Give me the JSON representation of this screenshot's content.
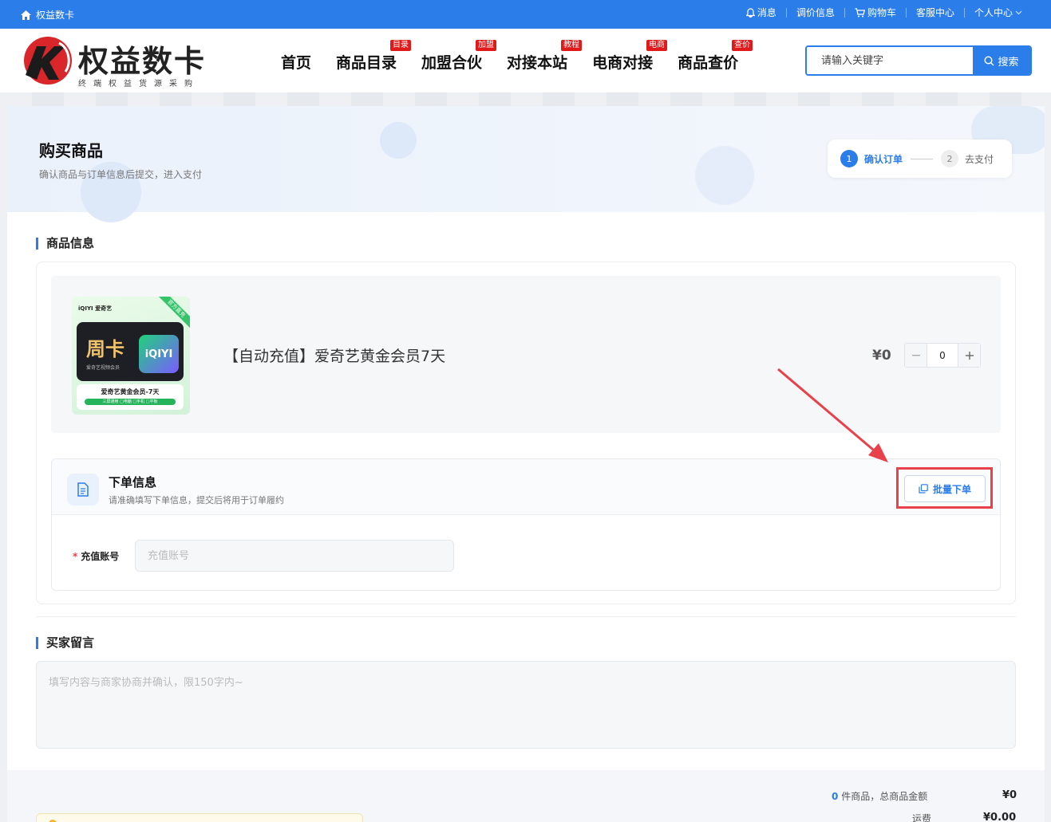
{
  "topbar": {
    "site_name": "权益数卡",
    "links": [
      "消息",
      "调价信息",
      "购物车",
      "客服中心",
      "个人中心"
    ]
  },
  "logo": {
    "name": "权益数卡",
    "slogan": "终端权益货源采购"
  },
  "nav": [
    {
      "label": "首页",
      "badge": ""
    },
    {
      "label": "商品目录",
      "badge": "目录"
    },
    {
      "label": "加盟合伙",
      "badge": "加盟"
    },
    {
      "label": "对接本站",
      "badge": "教程"
    },
    {
      "label": "电商对接",
      "badge": "电商"
    },
    {
      "label": "商品查价",
      "badge": "查价"
    }
  ],
  "search": {
    "placeholder": "请输入关键字",
    "button": "搜索"
  },
  "hero": {
    "title": "购买商品",
    "subtitle": "确认商品与订单信息后提交，进入支付"
  },
  "steps": [
    {
      "num": "1",
      "label": "确认订单"
    },
    {
      "num": "2",
      "label": "去支付"
    }
  ],
  "product_section": {
    "title": "商品信息"
  },
  "product": {
    "title": "【自动充值】爱奇艺黄金会员7天",
    "price": "¥0",
    "quantity": "0",
    "thumb": {
      "tag": "官方直充",
      "brand": "iQIYI 爱奇艺",
      "big_text": "周卡",
      "small_text": "爱奇艺视频会员",
      "logo_text": "iQIYI",
      "bottom_title": "爱奇艺黄金会员-7天",
      "bottom_bar": "三屏通用 □电脑 □手机 □平板"
    }
  },
  "order_info": {
    "title": "下单信息",
    "subtitle": "请准确填写下单信息，提交后将用于订单履约",
    "batch_button": "批量下单",
    "account_label": "充值账号",
    "account_placeholder": "充值账号"
  },
  "message_section": {
    "title": "买家留言",
    "placeholder": "填写内容与商家协商并确认，限150字内~"
  },
  "summary": {
    "count": "0",
    "count_text": "件商品，总商品金额",
    "amount": "¥0",
    "shipping_label": "运费",
    "shipping_value": "¥0.00"
  },
  "colors": {
    "primary": "#2b7de9",
    "badge": "#e01a1a",
    "highlight": "#e8414b"
  }
}
